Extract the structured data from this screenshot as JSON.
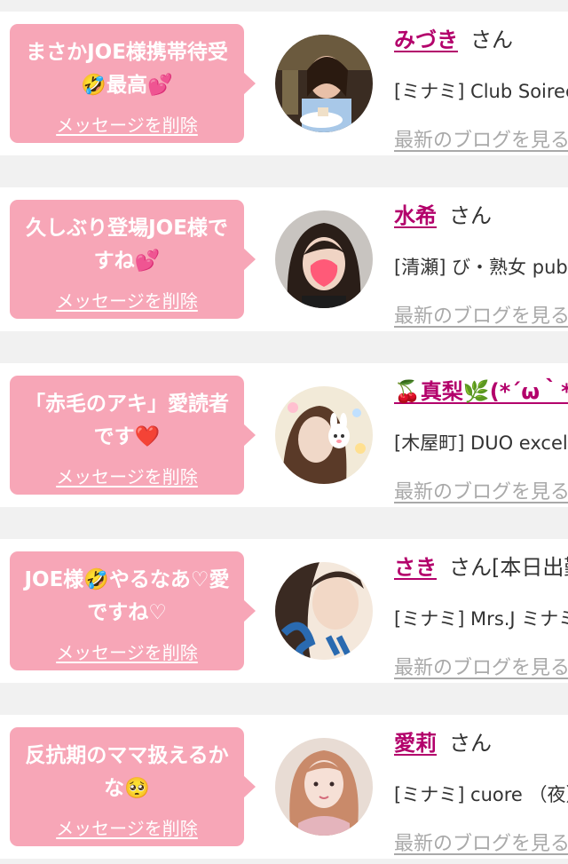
{
  "cards": [
    {
      "message": "まさかJOE様携帯待受🤣最高💕",
      "delete_label": "メッセージを削除",
      "name": "みづき",
      "suffix": "さん",
      "shop": "[ミナミ] Club Soiree",
      "blog_link": "最新のブログを見る"
    },
    {
      "message": "久しぶり登場JOE様ですね💕",
      "delete_label": "メッセージを削除",
      "name": "水希",
      "suffix": "さん",
      "shop": "[清瀬] び・熟女 pub",
      "blog_link": "最新のブログを見る"
    },
    {
      "message": "「赤毛のアキ」愛読者です❤️",
      "delete_label": "メッセージを削除",
      "name": "🍒真梨🌿(*´ω｀*)",
      "suffix": "",
      "shop": "[木屋町] DUO excellent",
      "blog_link": "最新のブログを見る"
    },
    {
      "message": "JOE様🤣やるなあ♡愛ですね♡",
      "delete_label": "メッセージを削除",
      "name": "さき",
      "suffix": "さん[本日出勤]",
      "shop": "[ミナミ] Mrs.J ミナミ",
      "blog_link": "最新のブログを見る"
    },
    {
      "message": "反抗期のママ扱えるかな🥺",
      "delete_label": "メッセージを削除",
      "name": "愛莉",
      "suffix": "さん",
      "shop": "[ミナミ] cuore （夜）",
      "blog_link": "最新のブログを見る"
    }
  ]
}
